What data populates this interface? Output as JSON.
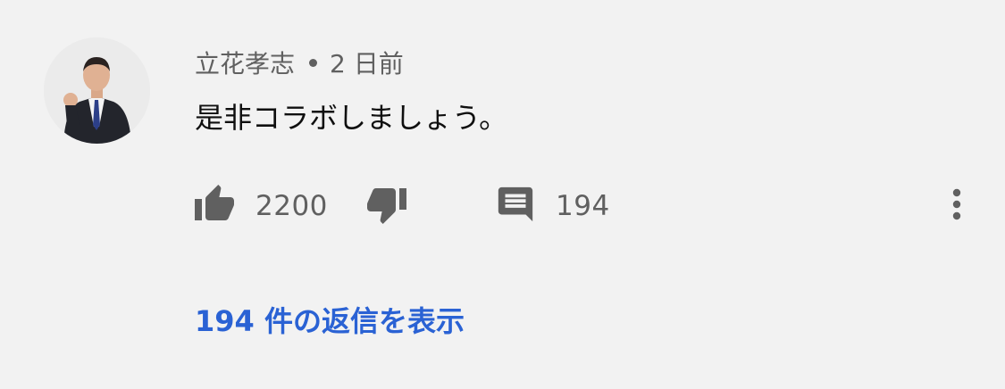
{
  "comment": {
    "author": "立花孝志",
    "time": "2 日前",
    "text": "是非コラボしましょう。",
    "like_count": "2200",
    "reply_count": "194",
    "view_replies_label": "194 件の返信を表示"
  },
  "icons": {
    "like": "thumb-up-icon",
    "dislike": "thumb-down-icon",
    "reply": "comment-icon",
    "more": "more-vertical-icon"
  },
  "colors": {
    "background": "#f2f2f2",
    "secondary_text": "#606060",
    "primary_text": "#0f0f0f",
    "link": "#2a62d4"
  }
}
